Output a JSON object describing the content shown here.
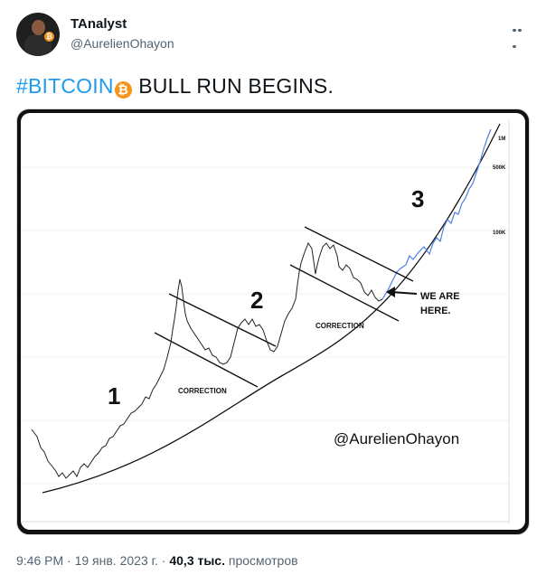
{
  "author": {
    "name": "TAnalyst",
    "handle": "@AurelienOhayon"
  },
  "tweet": {
    "hashtag": "#BITCOIN",
    "text": " BULL RUN BEGINS."
  },
  "chart": {
    "labels": {
      "wave1": "1",
      "wave2": "2",
      "wave3": "3",
      "correction1": "CORRECTION",
      "correction2": "CORRECTION",
      "we_are_here_line1": "WE ARE",
      "we_are_here_line2": "HERE.",
      "watermark": "@AurelienOhayon",
      "tick_1m": "1M",
      "tick_500k": "500K",
      "tick_100k": "100K"
    }
  },
  "footer": {
    "time": "9:46 PM",
    "sep1": " · ",
    "date": "19 янв. 2023 г.",
    "sep2": " · ",
    "views_count": "40,3 тыс.",
    "views_label": " просмотров"
  },
  "colors": {
    "accent": "#1d9bf0",
    "bitcoin": "#f7931a",
    "projection": "#4f7fe8"
  }
}
